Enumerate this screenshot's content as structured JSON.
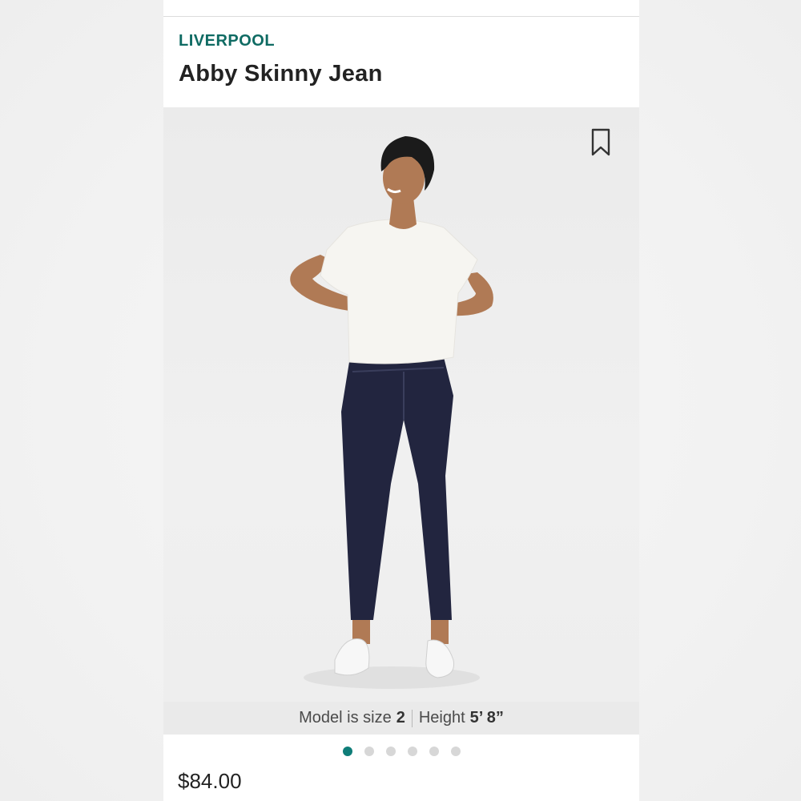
{
  "product": {
    "brand": "LIVERPOOL",
    "title": "Abby Skinny Jean",
    "price": "$84.00"
  },
  "image": {
    "caption": {
      "size_label": "Model is size",
      "size_value": "2",
      "height_label": "Height",
      "height_value": "5’ 8”"
    },
    "carousel": {
      "count": 6,
      "active_index": 0
    }
  },
  "icons": {
    "bookmark": "bookmark-icon"
  },
  "colors": {
    "brand": "#0f6b63",
    "active_dot": "#0f7d78",
    "denim": "#22253f"
  }
}
